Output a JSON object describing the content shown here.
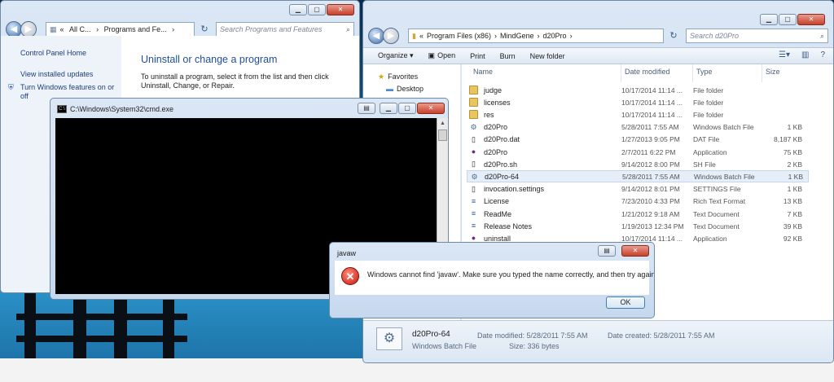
{
  "control_panel": {
    "breadcrumb": [
      "«",
      "All C...",
      "›",
      "Programs and Fe...",
      "›"
    ],
    "search_placeholder": "Search Programs and Features",
    "left_links": [
      "Control Panel Home",
      "View installed updates",
      "Turn Windows features on or off"
    ],
    "title": "Uninstall or change a program",
    "description": "To uninstall a program, select it from the list and then click Uninstall, Change, or Repair."
  },
  "cmd": {
    "title": "C:\\Windows\\System32\\cmd.exe"
  },
  "explorer": {
    "breadcrumb": [
      "«",
      "Program Files (x86)",
      "›",
      "MindGene",
      "›",
      "d20Pro",
      "›"
    ],
    "search_placeholder": "Search d20Pro",
    "toolbar": [
      "Organize ▾",
      "Open",
      "Print",
      "Burn",
      "New folder"
    ],
    "nav": {
      "favorites": "Favorites",
      "desktop": "Desktop"
    },
    "columns": [
      "Name",
      "Date modified",
      "Type",
      "Size"
    ],
    "files": [
      {
        "name": "judge",
        "date": "10/17/2014 11:14 ...",
        "type": "File folder",
        "size": "",
        "icon": "folder-icon"
      },
      {
        "name": "licenses",
        "date": "10/17/2014 11:14 ...",
        "type": "File folder",
        "size": "",
        "icon": "folder-icon"
      },
      {
        "name": "res",
        "date": "10/17/2014 11:14 ...",
        "type": "File folder",
        "size": "",
        "icon": "folder-icon"
      },
      {
        "name": "d20Pro",
        "date": "5/28/2011 7:55 AM",
        "type": "Windows Batch File",
        "size": "1 KB",
        "icon": "gear-icon"
      },
      {
        "name": "d20Pro.dat",
        "date": "1/27/2013 9:05 PM",
        "type": "DAT File",
        "size": "8,187 KB",
        "icon": "file-icon"
      },
      {
        "name": "d20Pro",
        "date": "2/7/2011 6:22 PM",
        "type": "Application",
        "size": "75 KB",
        "icon": "app-icon"
      },
      {
        "name": "d20Pro.sh",
        "date": "9/14/2012 8:00 PM",
        "type": "SH File",
        "size": "2 KB",
        "icon": "file-icon"
      },
      {
        "name": "d20Pro-64",
        "date": "5/28/2011 7:55 AM",
        "type": "Windows Batch File",
        "size": "1 KB",
        "icon": "gear-icon"
      },
      {
        "name": "invocation.settings",
        "date": "9/14/2012 8:01 PM",
        "type": "SETTINGS File",
        "size": "1 KB",
        "icon": "file-icon"
      },
      {
        "name": "License",
        "date": "7/23/2010 4:33 PM",
        "type": "Rich Text Format",
        "size": "13 KB",
        "icon": "document-icon"
      },
      {
        "name": "ReadMe",
        "date": "1/21/2012 9:18 AM",
        "type": "Text Document",
        "size": "7 KB",
        "icon": "document-icon"
      },
      {
        "name": "Release Notes",
        "date": "1/19/2013 12:34 PM",
        "type": "Text Document",
        "size": "39 KB",
        "icon": "document-icon"
      },
      {
        "name": "uninstall",
        "date": "10/17/2014 11:14 ...",
        "type": "Application",
        "size": "92 KB",
        "icon": "app-icon"
      }
    ],
    "details": {
      "name": "d20Pro-64",
      "type": "Windows Batch File",
      "modified_label": "Date modified:",
      "modified": "5/28/2011 7:55 AM",
      "created_label": "Date created:",
      "created": "5/28/2011 7:55 AM",
      "size_label": "Size:",
      "size": "336 bytes"
    }
  },
  "dialog": {
    "title": "javaw",
    "message": "Windows cannot find 'javaw'. Make sure you typed the name correctly, and then try again.",
    "ok": "OK"
  }
}
